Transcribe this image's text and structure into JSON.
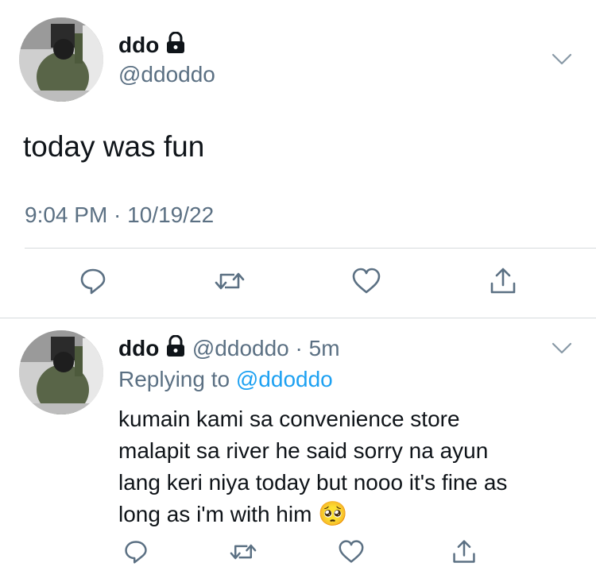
{
  "main_tweet": {
    "display_name": "ddo",
    "handle": "@ddoddo",
    "text": "today was fun",
    "timestamp": "9:04 PM · 10/19/22"
  },
  "reply_tweet": {
    "display_name": "ddo",
    "handle": "@ddoddo",
    "time_sep": "·",
    "age": "5m",
    "replying_prefix": "Replying to ",
    "replying_handle": "@ddoddo",
    "text_lines": [
      "kumain kami sa convenience store",
      "malapit sa river he said sorry na ayun",
      "lang keri niya today but nooo it's fine as",
      "long as i'm with him"
    ],
    "emoji": "🥺"
  },
  "icons": {
    "lock": "lock-icon",
    "more": "chevron-down-icon",
    "reply": "reply-icon",
    "retweet": "retweet-icon",
    "like": "heart-icon",
    "share": "share-icon"
  },
  "colors": {
    "text": "#0f1419",
    "muted": "#5b7083",
    "link": "#1da1f2",
    "divider": "#d6dadd"
  }
}
